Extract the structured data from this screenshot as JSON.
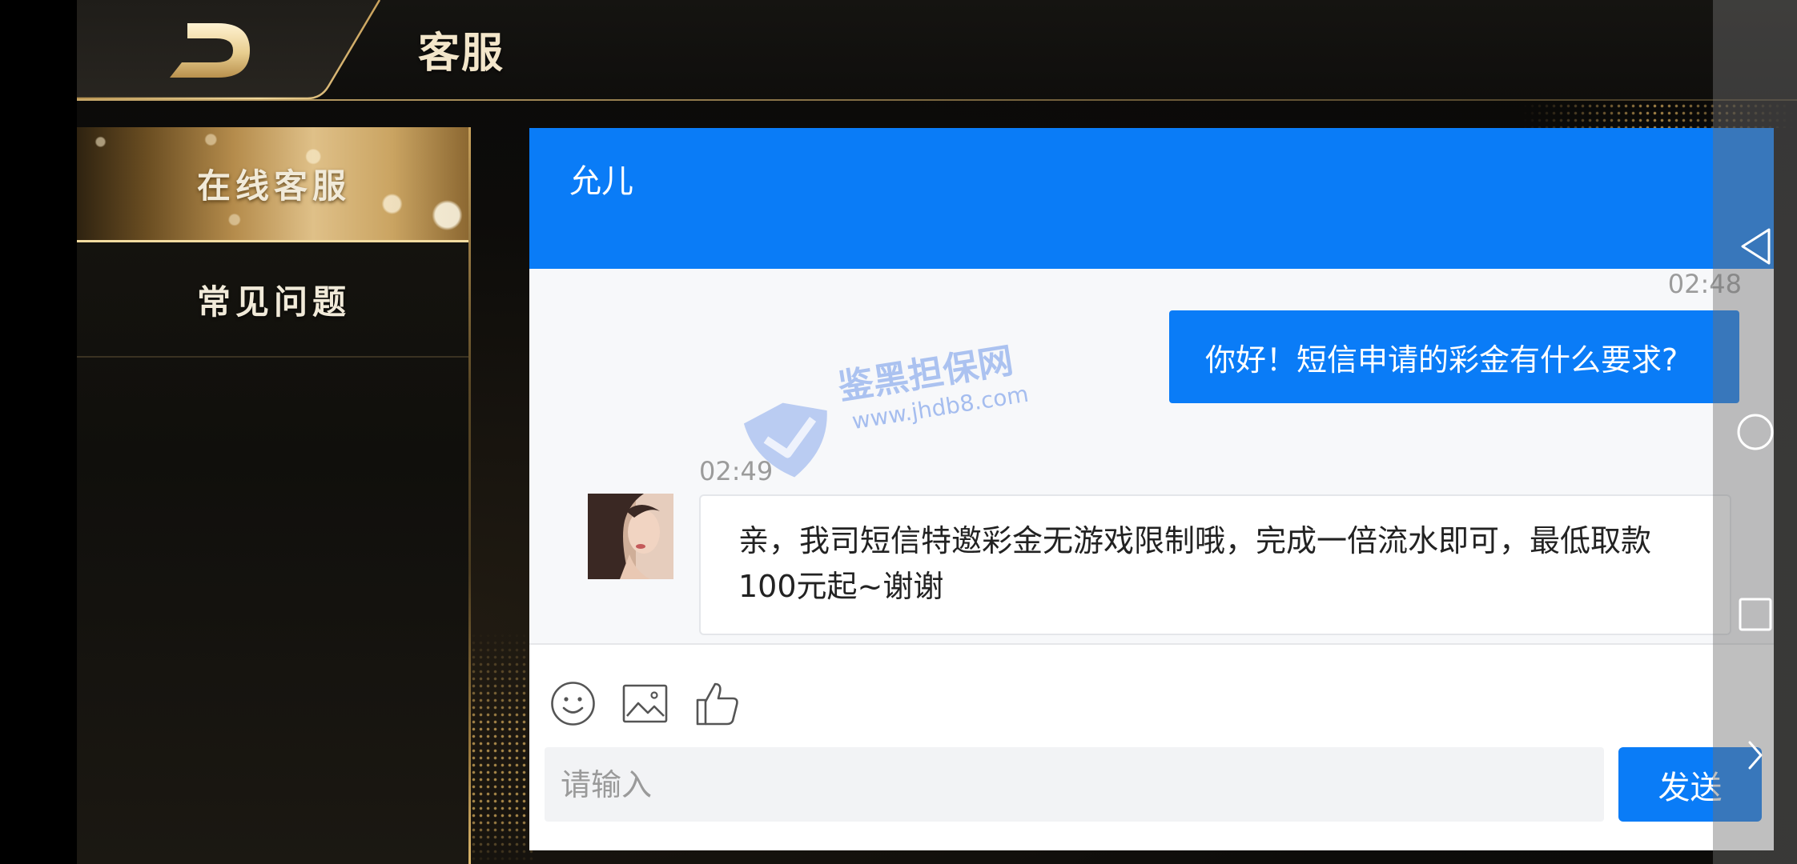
{
  "header": {
    "title": "客服",
    "logo_icon": "back-logo-icon"
  },
  "sidebar": {
    "items": [
      {
        "label": "在线客服",
        "active": true
      },
      {
        "label": "常见问题",
        "active": false
      }
    ]
  },
  "chat": {
    "agent_name": "允儿",
    "messages": [
      {
        "from": "user",
        "time": "02:48",
        "text": "你好！短信申请的彩金有什么要求?"
      },
      {
        "from": "agent",
        "time": "02:49",
        "text": "亲，我司短信特邀彩金无游戏限制哦，完成一倍流水即可，最低取款100元起~谢谢"
      }
    ],
    "toolbar": {
      "emoji_icon": "smiley-icon",
      "image_icon": "image-icon",
      "like_icon": "thumbs-up-icon"
    },
    "input": {
      "placeholder": "请输入",
      "value": ""
    },
    "send_label": "发送"
  },
  "watermark": {
    "name": "鉴黑担保网",
    "url": "www.jhdb8.com"
  },
  "system_nav": {
    "back_icon": "back-triangle-icon",
    "home_icon": "home-circle-icon",
    "recents_icon": "recents-square-icon",
    "expand_icon": "chevron-right-icon"
  },
  "colors": {
    "accent": "#0a7cf7",
    "gold": "#d4b06a",
    "background": "#0c0b09"
  }
}
